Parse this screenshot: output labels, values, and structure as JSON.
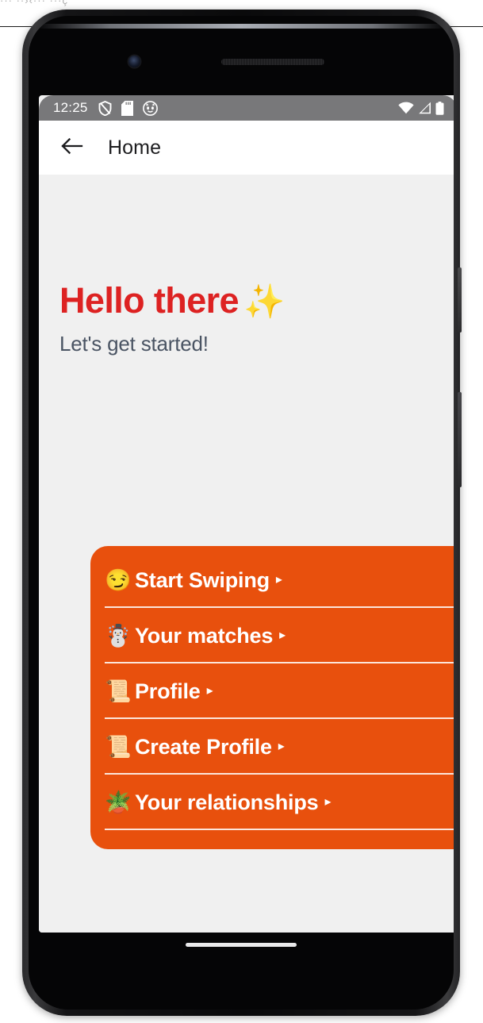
{
  "page_background_text": "··· ··›‹···  ···ç",
  "device": {
    "name": "android-phone",
    "frame_color": "#111214",
    "buttons": [
      "power-button",
      "volume-rocker"
    ]
  },
  "status_bar": {
    "time": "12:25",
    "background_color": "#78787a",
    "left_icons": [
      "shield-icon",
      "sd-card-icon",
      "cat-face-icon"
    ],
    "right_icons": [
      "wifi-icon",
      "cellular-signal-icon",
      "battery-icon"
    ]
  },
  "app_bar": {
    "back_label": "back-arrow",
    "title": "Home",
    "background_color": "#ffffff",
    "title_color": "#1d1d1f"
  },
  "hero": {
    "title": "Hello there",
    "title_emoji": "✨",
    "title_color": "#dd2222",
    "subtitle": "Let's get started!",
    "subtitle_color": "#4a5463"
  },
  "menu": {
    "background_color": "#e8500d",
    "text_color": "#ffffff",
    "caret": "▸",
    "items": [
      {
        "emoji": "😏",
        "emoji_name": "smirking-face-icon",
        "label": "Start Swiping"
      },
      {
        "emoji": "☃️",
        "emoji_name": "snowman-icon",
        "label": "Your matches"
      },
      {
        "emoji": "📜",
        "emoji_name": "scroll-icon",
        "label": "Profile"
      },
      {
        "emoji": "📜",
        "emoji_name": "scroll-icon",
        "label": "Create Profile"
      },
      {
        "emoji": "🪴",
        "emoji_name": "potted-plant-icon",
        "label": "Your relationships"
      }
    ]
  },
  "screen": {
    "background_color": "#f0f0f0"
  },
  "navigation": {
    "gesture_pill": "home-gesture-pill"
  }
}
